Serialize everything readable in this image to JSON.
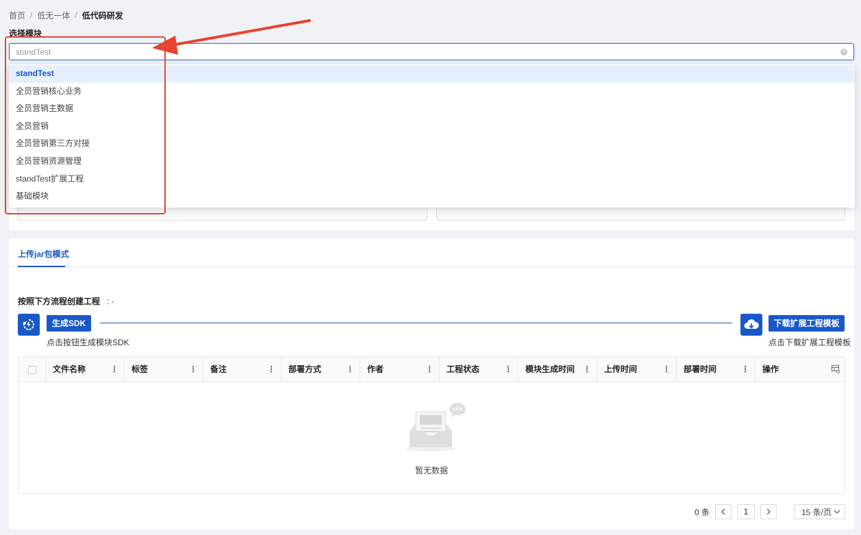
{
  "breadcrumb": {
    "items": [
      "首页",
      "低无一体",
      "低代码研发"
    ],
    "separator": "/"
  },
  "select_module": {
    "label": "选择模块",
    "placeholder": "standTest",
    "options": [
      "standTest",
      "全员营销核心业务",
      "全员营销主数据",
      "全员营销",
      "全员营销第三方对接",
      "全员营销资源管理",
      "standTest扩展工程",
      "基础模块"
    ],
    "selected": "standTest"
  },
  "tabs": [
    {
      "label": "上传jar包模式",
      "active": true
    }
  ],
  "flow": {
    "title": "按照下方流程创建工程",
    "title_suffix": ": -",
    "generate_button": "生成SDK",
    "generate_note": "点击按钮生成模块SDK",
    "download_button": "下载扩展工程模板",
    "download_note": "点击下载扩展工程模板"
  },
  "table": {
    "columns": [
      "文件名称",
      "标签",
      "备注",
      "部署方式",
      "作者",
      "工程状态",
      "模块生成时间",
      "上传时间",
      "部署时间",
      "操作"
    ],
    "empty_text": "暂无数据"
  },
  "pagination": {
    "total": "0 条",
    "current_page": "1",
    "page_size": "15 条/页"
  },
  "colors": {
    "primary": "#1859c9",
    "annotation": "#e8432f",
    "background": "#f0f2f5"
  },
  "icons": [
    "sync-icon",
    "cloud-download-icon",
    "clear-icon",
    "column-settings-icon",
    "chevron-left-icon",
    "chevron-right-icon",
    "chevron-down-icon",
    "empty-inbox-icon",
    "chat-bubble-icon"
  ]
}
